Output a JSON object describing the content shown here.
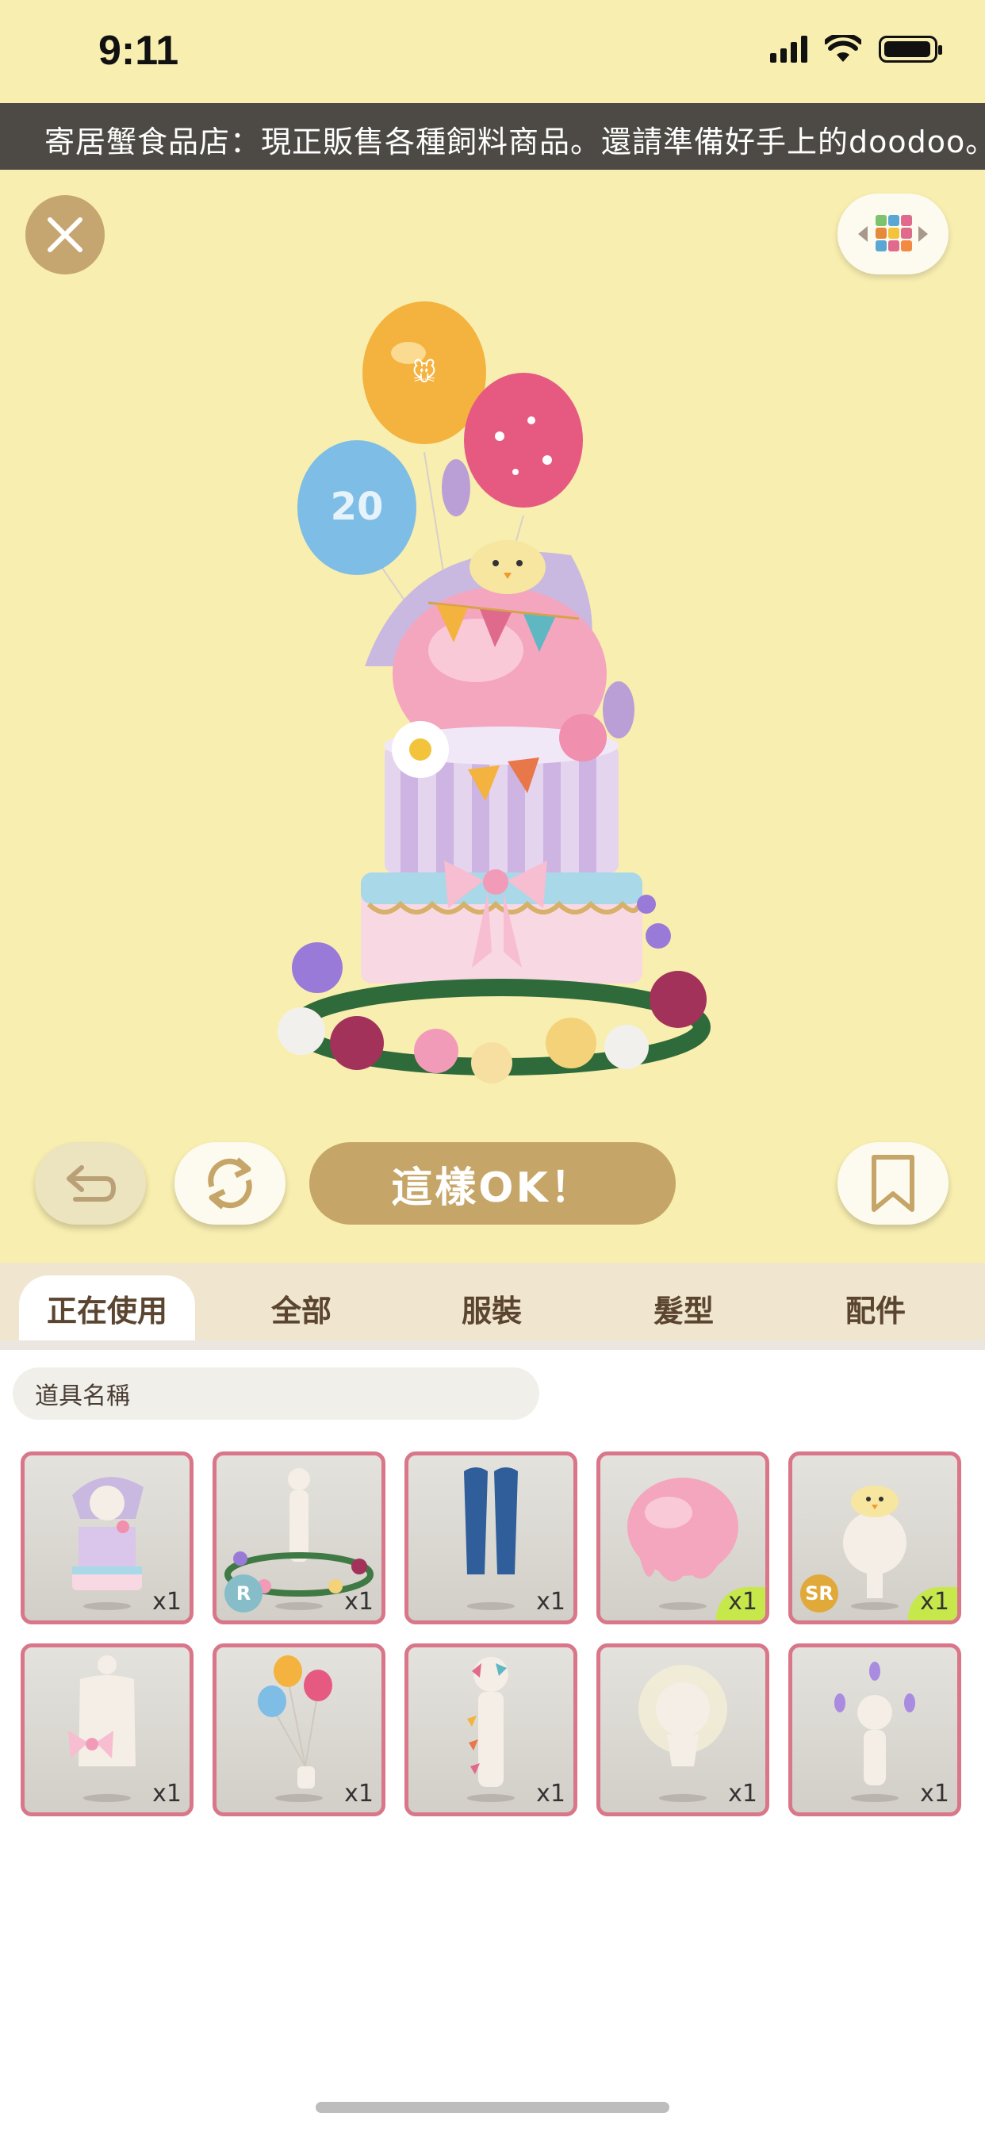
{
  "status_bar": {
    "time": "9:11"
  },
  "ticker": {
    "text": "寄居蟹食品店：現正販售各種飼料商品。還請準備好手上的doodoo。"
  },
  "actions": {
    "ok_label": "這樣OK！"
  },
  "tabs": [
    {
      "label": "正在使用",
      "active": true
    },
    {
      "label": "全部",
      "active": false
    },
    {
      "label": "服裝",
      "active": false
    },
    {
      "label": "髮型",
      "active": false
    },
    {
      "label": "配件",
      "active": false
    }
  ],
  "search": {
    "placeholder": "道具名稱"
  },
  "items": [
    {
      "icon": "cake-outfit-icon",
      "qty": "x1"
    },
    {
      "icon": "flower-ring-icon",
      "qty": "x1",
      "rarity": "R"
    },
    {
      "icon": "blue-pants-icon",
      "qty": "x1"
    },
    {
      "icon": "pink-scoop-hair-icon",
      "qty": "x1",
      "new": true
    },
    {
      "icon": "chick-hat-icon",
      "qty": "x1",
      "rarity": "SR",
      "new": true
    },
    {
      "icon": "bow-top-icon",
      "qty": "x1"
    },
    {
      "icon": "balloons-icon",
      "qty": "x1"
    },
    {
      "icon": "bunting-icon",
      "qty": "x1"
    },
    {
      "icon": "glow-aura-icon",
      "qty": "x1"
    },
    {
      "icon": "purple-flames-icon",
      "qty": "x1"
    }
  ],
  "colors": {
    "background": "#f8eeb0",
    "accent": "#c6a668",
    "item_border": "#d9768a",
    "new_badge": "#c7e84a",
    "rarity_r": "#86bdc9",
    "rarity_sr": "#e0a93a"
  }
}
